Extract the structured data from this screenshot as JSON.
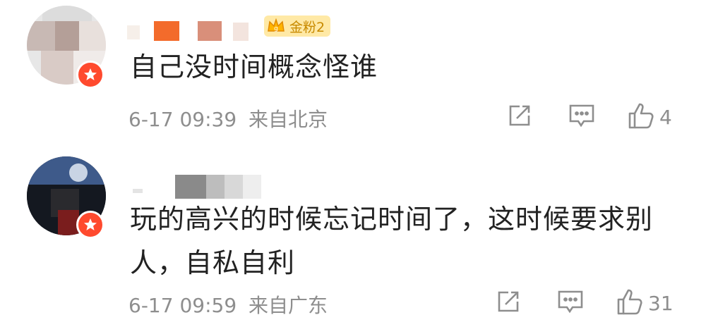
{
  "comments": [
    {
      "vip_badge": "金粉2",
      "text": "自己没时间概念怪谁",
      "timestamp": "6-17 09:39",
      "location": "来自北京",
      "like_count": "4",
      "icons": [
        "share-icon",
        "comment-icon",
        "like-icon"
      ]
    },
    {
      "text_line1": "玩的高兴的时候忘记时间了，这时候要求别",
      "text_line2": "人，自私自利",
      "timestamp": "6-17 09:59",
      "location": "来自广东",
      "like_count": "31",
      "icons": [
        "share-icon",
        "comment-icon",
        "like-icon"
      ]
    }
  ],
  "colors": {
    "badge": "#ff4a2e",
    "meta_text": "#8e8e8e",
    "vip_bg": "#ffe9a6",
    "vip_text": "#c88a00"
  }
}
